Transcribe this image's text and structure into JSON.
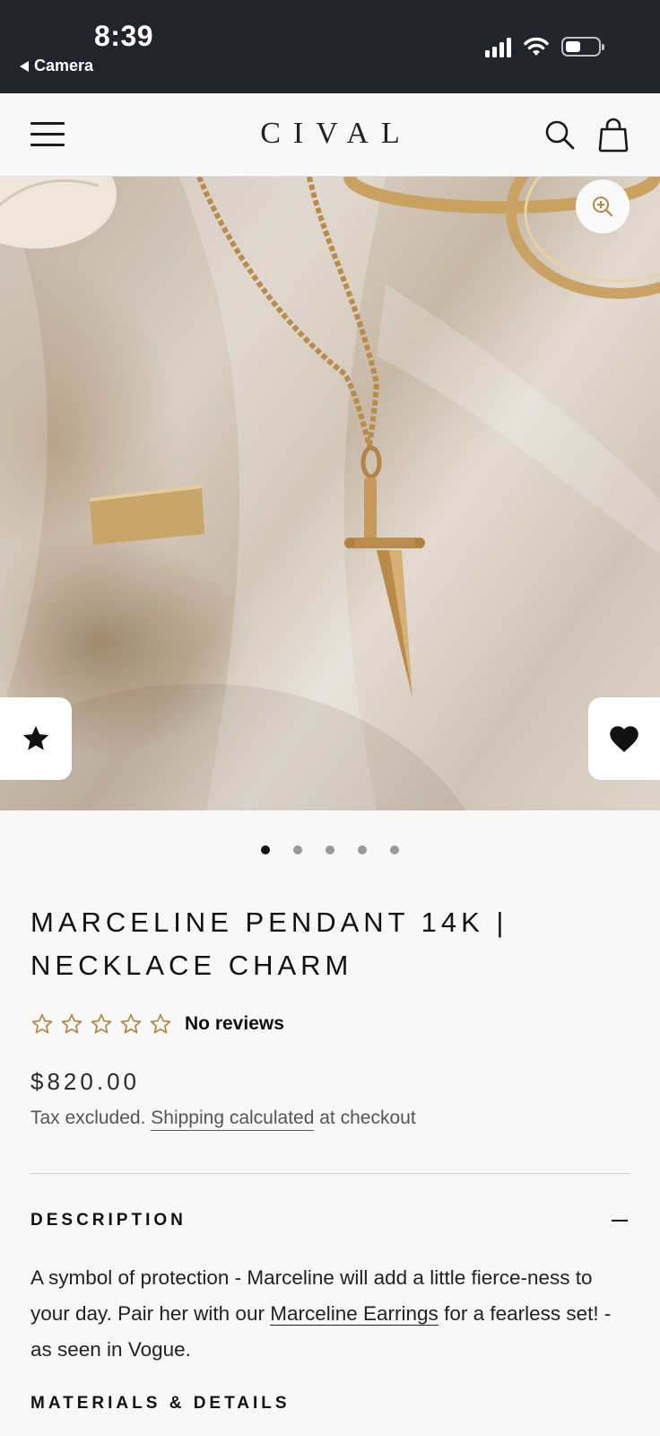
{
  "status_bar": {
    "time": "8:39",
    "back_label": "Camera",
    "icons": [
      "signal-icon",
      "wifi-icon",
      "battery-icon"
    ]
  },
  "header": {
    "logo": "CIVAL",
    "icons": [
      "menu-icon",
      "search-icon",
      "cart-icon"
    ]
  },
  "gallery": {
    "image_alt": "Gold dagger pendant necklace on beige silk with rings",
    "slide_count": 5,
    "active_slide": 1,
    "zoom_icon": "zoom-in-icon",
    "left_action_icon": "star-icon",
    "right_action_icon": "heart-icon"
  },
  "product": {
    "title": "MARCELINE PENDANT 14K | NECKLACE CHARM",
    "rating_stars": 0,
    "rating_max": 5,
    "reviews_label": "No reviews",
    "price": "$820.00",
    "tax_prefix": "Tax excluded.",
    "shipping_link": "Shipping calculated",
    "tax_suffix": "at checkout"
  },
  "description": {
    "heading": "DESCRIPTION",
    "text_before": "A symbol of protection - Marceline will add a little fierce-ness to your day. Pair her with our",
    "link": "Marceline Earrings",
    "text_after": "for a fearless set! - as seen in Vogue."
  },
  "materials": {
    "heading": "MATERIALS & DETAILS"
  },
  "colors": {
    "status_bar_bg": "#22242b",
    "page_bg": "#f8f8f8",
    "star_outline": "#b08a4a",
    "text": "#111111"
  }
}
